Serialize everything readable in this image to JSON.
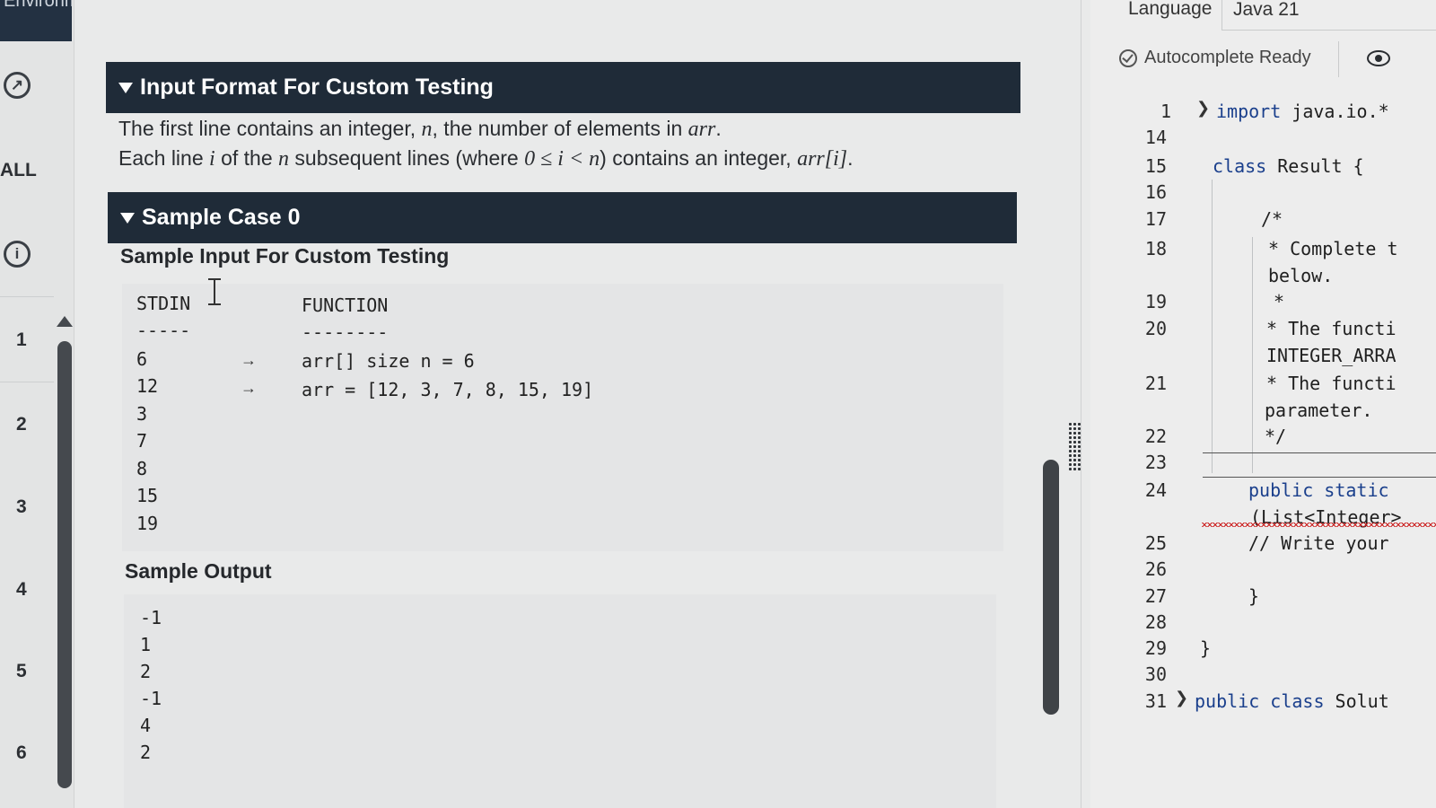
{
  "rail": {
    "top_fragment": "Environment",
    "all_label": "ALL",
    "question_numbers": [
      "1",
      "2",
      "3",
      "4",
      "5",
      "6"
    ]
  },
  "input_format": {
    "title": "Input Format For Custom Testing",
    "line1": {
      "a": "The first line contains an integer, ",
      "n": "n",
      "b": ", the number of elements in ",
      "arr": "arr",
      "c": "."
    },
    "line2": {
      "a": "Each line ",
      "i": "i",
      "b": " of the ",
      "n": "n",
      "c": " subsequent lines (where ",
      "cond": "0 ≤ i < n",
      "d": ") contains an integer, ",
      "arr": "arr[i]",
      "e": "."
    }
  },
  "sample_case": {
    "title": "Sample Case 0",
    "input_heading": "Sample Input For Custom Testing",
    "stdin_header": "STDIN",
    "stdin_rule": "-----",
    "function_header": "FUNCTION",
    "function_rule": "--------",
    "stdin_values": [
      "6",
      "12",
      "3",
      "7",
      "8",
      "15",
      "19"
    ],
    "arrow": "→",
    "function_lines": [
      "arr[] size n = 6",
      "arr = [12, 3, 7, 8, 15, 19]"
    ],
    "output_heading": "Sample Output",
    "output_values": [
      "-1",
      "1",
      "2",
      "-1",
      "4",
      "2"
    ]
  },
  "editor": {
    "language_label": "Language",
    "language_value": "Java 21",
    "autocomplete": "Autocomplete Ready",
    "lines": [
      {
        "n": "1",
        "fold": true,
        "text": "import java.io.*",
        "kw": true
      },
      {
        "n": "14",
        "text": ""
      },
      {
        "n": "15",
        "text": "class Result {",
        "kw": true
      },
      {
        "n": "16",
        "text": ""
      },
      {
        "n": "17",
        "text": "/*"
      },
      {
        "n": "18",
        "text": "* Complete t"
      },
      {
        "n": "",
        "text": "below."
      },
      {
        "n": "19",
        "text": "*"
      },
      {
        "n": "20",
        "text": "* The functi"
      },
      {
        "n": "",
        "text": "INTEGER_ARRA"
      },
      {
        "n": "21",
        "text": "* The functi"
      },
      {
        "n": "",
        "text": "parameter."
      },
      {
        "n": "22",
        "text": "*/"
      },
      {
        "n": "23",
        "text": ""
      },
      {
        "n": "24",
        "text": "public static",
        "kw": true
      },
      {
        "n": "",
        "text": "(List<Integer>"
      },
      {
        "n": "25",
        "text": "// Write your"
      },
      {
        "n": "26",
        "text": ""
      },
      {
        "n": "27",
        "text": "}"
      },
      {
        "n": "28",
        "text": ""
      },
      {
        "n": "29",
        "text": "}"
      },
      {
        "n": "30",
        "text": ""
      },
      {
        "n": "31",
        "fold": true,
        "text": "public class Solut",
        "kw": true
      }
    ]
  }
}
